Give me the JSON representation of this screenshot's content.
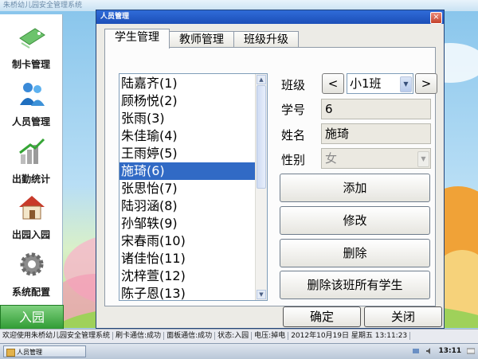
{
  "app": {
    "window_title": "朱桥幼儿园安全管理系统",
    "sidebar": [
      {
        "label": "制卡管理",
        "icon": "card-icon"
      },
      {
        "label": "人员管理",
        "icon": "people-icon"
      },
      {
        "label": "出勤统计",
        "icon": "bar-chart-icon"
      },
      {
        "label": "出园入园",
        "icon": "house-icon"
      },
      {
        "label": "系统配置",
        "icon": "gear-icon"
      }
    ],
    "entry_button": "入园"
  },
  "dialog": {
    "title": "人员管理",
    "close_symbol": "×",
    "tabs": [
      "学生管理",
      "教师管理",
      "班级升级"
    ],
    "active_tab": 0,
    "students": [
      "陆嘉齐(1)",
      "顾杨悦(2)",
      "张雨(3)",
      "朱佳瑜(4)",
      "王雨婷(5)",
      "施琦(6)",
      "张思怡(7)",
      "陆羽涵(8)",
      "孙邹轶(9)",
      "宋春雨(10)",
      "诸佳怡(11)",
      "沈梓萱(12)",
      "陈子恩(13)"
    ],
    "selected_student": "施琦(6)",
    "form": {
      "class_label": "班级",
      "prev_symbol": "<",
      "next_symbol": ">",
      "class_value": "小1班",
      "id_label": "学号",
      "id_value": "6",
      "name_label": "姓名",
      "name_value": "施琦",
      "gender_label": "性别",
      "gender_value": "女"
    },
    "actions": {
      "add": "添加",
      "edit": "修改",
      "delete": "删除",
      "delete_all": "删除该班所有学生"
    },
    "ok_button": "确定",
    "close_button": "关闭"
  },
  "status_bar": [
    "欢迎使用朱桥幼儿园安全管理系统",
    "刷卡通信:成功",
    "面板通信:成功",
    "状态:入园",
    "电压:掉电",
    "2012年10月19日 星期五 13:11:23"
  ],
  "taskbar": {
    "task_label": "人员管理",
    "clock": "13:11"
  },
  "colors": {
    "title_bar": "#1c4fb8",
    "selection": "#316ac5",
    "entry_green": "#2e9a32"
  }
}
